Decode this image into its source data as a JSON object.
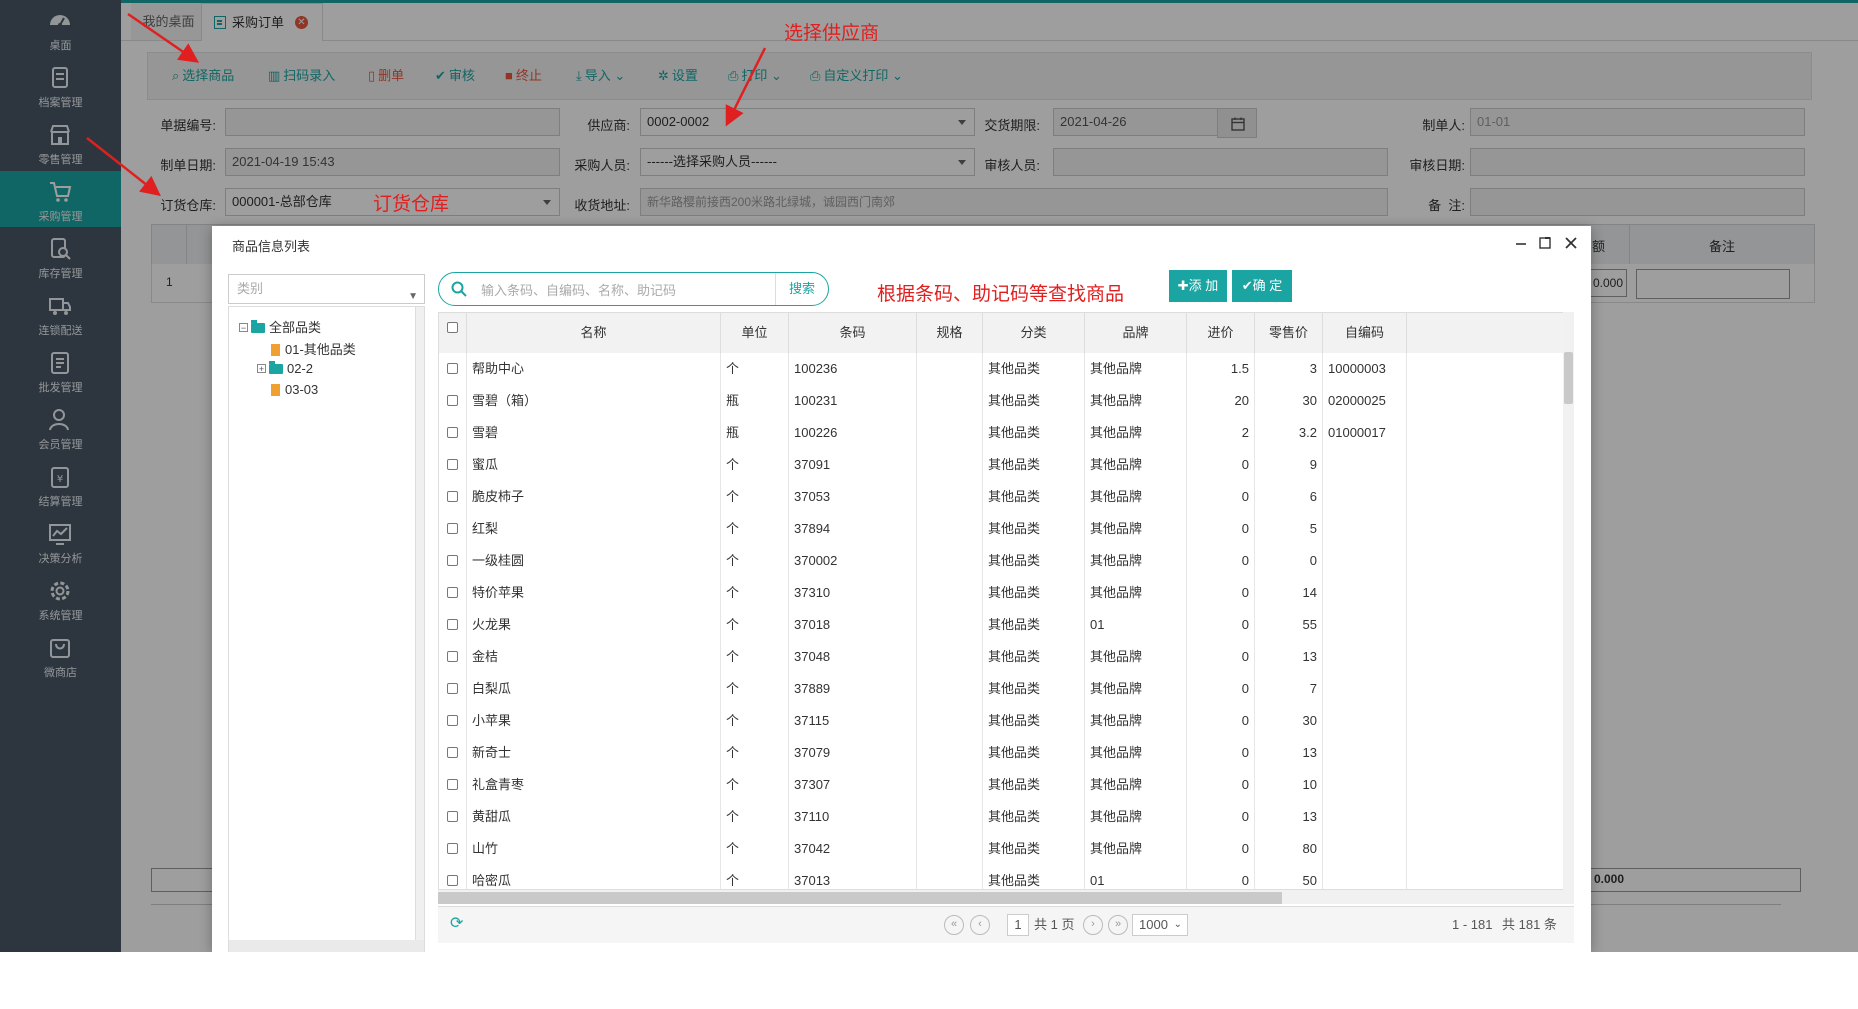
{
  "sidebar": {
    "items": [
      {
        "label": "桌面",
        "icon": "dashboard-icon"
      },
      {
        "label": "档案管理",
        "icon": "archive-icon"
      },
      {
        "label": "零售管理",
        "icon": "store-icon"
      },
      {
        "label": "采购管理",
        "icon": "purchase-icon",
        "active": true
      },
      {
        "label": "库存管理",
        "icon": "inventory-icon"
      },
      {
        "label": "连锁配送",
        "icon": "delivery-icon"
      },
      {
        "label": "批发管理",
        "icon": "wholesale-icon"
      },
      {
        "label": "会员管理",
        "icon": "member-icon"
      },
      {
        "label": "结算管理",
        "icon": "settlement-icon"
      },
      {
        "label": "决策分析",
        "icon": "analysis-icon"
      },
      {
        "label": "系统管理",
        "icon": "gear-icon"
      },
      {
        "label": "微商店",
        "icon": "shop-bag-icon"
      }
    ]
  },
  "tabs": {
    "desktop": "我的桌面",
    "purchase_order": "采购订单"
  },
  "toolbar": {
    "select_goods": "选择商品",
    "scan_entry": "扫码录入",
    "delete": "删单",
    "audit": "审核",
    "terminate": "终止",
    "import": "导入",
    "settings": "设置",
    "print": "打印",
    "custom_print": "自定义打印"
  },
  "form": {
    "doc_no_label": "单据编号:",
    "doc_no": "",
    "supplier_label": "供应商:",
    "supplier": "0002-0002",
    "deadline_label": "交货期限:",
    "deadline": "2021-04-26",
    "maker_label": "制单人:",
    "maker": "01-01",
    "date_label": "制单日期:",
    "date": "2021-04-19 15:43",
    "buyer_label": "采购人员:",
    "buyer": "------选择采购人员------",
    "auditor_label": "审核人员:",
    "auditor": "",
    "audit_date_label": "审核日期:",
    "audit_date": "",
    "warehouse_label": "订货仓库:",
    "warehouse": "000001-总部仓库",
    "address_label": "收货地址:",
    "address": "新华路樱前接西200米路北绿城，诚园西门南郊",
    "remark_label": "备  注:",
    "remark": ""
  },
  "bg_grid": {
    "remark_header": "备注",
    "row_no": "1",
    "amount": "0.000",
    "total": "0.000",
    "col_tail": "额"
  },
  "modal": {
    "title": "商品信息列表",
    "category_placeholder": "类别",
    "tree": [
      {
        "label": "全部品类"
      },
      {
        "label": "01-其他品类"
      },
      {
        "label": "02-2"
      },
      {
        "label": "03-03"
      }
    ],
    "search_placeholder": "输入条码、自编码、名称、助记码",
    "search_button": "搜索",
    "add_button": "添 加",
    "confirm_button": "确 定",
    "columns": [
      "名称",
      "单位",
      "条码",
      "规格",
      "分类",
      "品牌",
      "进价",
      "零售价",
      "自编码"
    ],
    "rows": [
      {
        "name": "帮助中心",
        "unit": "个",
        "barcode": "100236",
        "spec": "",
        "category": "其他品类",
        "brand": "其他品牌",
        "cost": "1.5",
        "price": "3",
        "code": "10000003"
      },
      {
        "name": "雪碧（箱）",
        "unit": "瓶",
        "barcode": "100231",
        "spec": "",
        "category": "其他品类",
        "brand": "其他品牌",
        "cost": "20",
        "price": "30",
        "code": "02000025"
      },
      {
        "name": "雪碧",
        "unit": "瓶",
        "barcode": "100226",
        "spec": "",
        "category": "其他品类",
        "brand": "其他品牌",
        "cost": "2",
        "price": "3.2",
        "code": "01000017"
      },
      {
        "name": "蜜瓜",
        "unit": "个",
        "barcode": "37091",
        "spec": "",
        "category": "其他品类",
        "brand": "其他品牌",
        "cost": "0",
        "price": "9",
        "code": ""
      },
      {
        "name": "脆皮柿子",
        "unit": "个",
        "barcode": "37053",
        "spec": "",
        "category": "其他品类",
        "brand": "其他品牌",
        "cost": "0",
        "price": "6",
        "code": ""
      },
      {
        "name": "红梨",
        "unit": "个",
        "barcode": "37894",
        "spec": "",
        "category": "其他品类",
        "brand": "其他品牌",
        "cost": "0",
        "price": "5",
        "code": ""
      },
      {
        "name": "一级桂圆",
        "unit": "个",
        "barcode": "370002",
        "spec": "",
        "category": "其他品类",
        "brand": "其他品牌",
        "cost": "0",
        "price": "0",
        "code": ""
      },
      {
        "name": "特价苹果",
        "unit": "个",
        "barcode": "37310",
        "spec": "",
        "category": "其他品类",
        "brand": "其他品牌",
        "cost": "0",
        "price": "14",
        "code": ""
      },
      {
        "name": "火龙果",
        "unit": "个",
        "barcode": "37018",
        "spec": "",
        "category": "其他品类",
        "brand": "01",
        "cost": "0",
        "price": "55",
        "code": ""
      },
      {
        "name": "金桔",
        "unit": "个",
        "barcode": "37048",
        "spec": "",
        "category": "其他品类",
        "brand": "其他品牌",
        "cost": "0",
        "price": "13",
        "code": ""
      },
      {
        "name": "白梨瓜",
        "unit": "个",
        "barcode": "37889",
        "spec": "",
        "category": "其他品类",
        "brand": "其他品牌",
        "cost": "0",
        "price": "7",
        "code": ""
      },
      {
        "name": "小苹果",
        "unit": "个",
        "barcode": "37115",
        "spec": "",
        "category": "其他品类",
        "brand": "其他品牌",
        "cost": "0",
        "price": "30",
        "code": ""
      },
      {
        "name": "新奇士",
        "unit": "个",
        "barcode": "37079",
        "spec": "",
        "category": "其他品类",
        "brand": "其他品牌",
        "cost": "0",
        "price": "13",
        "code": ""
      },
      {
        "name": "礼盒青枣",
        "unit": "个",
        "barcode": "37307",
        "spec": "",
        "category": "其他品类",
        "brand": "其他品牌",
        "cost": "0",
        "price": "10",
        "code": ""
      },
      {
        "name": "黄甜瓜",
        "unit": "个",
        "barcode": "37110",
        "spec": "",
        "category": "其他品类",
        "brand": "其他品牌",
        "cost": "0",
        "price": "13",
        "code": ""
      },
      {
        "name": "山竹",
        "unit": "个",
        "barcode": "37042",
        "spec": "",
        "category": "其他品类",
        "brand": "其他品牌",
        "cost": "0",
        "price": "80",
        "code": ""
      },
      {
        "name": "哈密瓜",
        "unit": "个",
        "barcode": "37013",
        "spec": "",
        "category": "其他品类",
        "brand": "01",
        "cost": "0",
        "price": "50",
        "code": ""
      }
    ],
    "pager": {
      "page": "1",
      "total_pages": "共 1 页",
      "page_size": "1000",
      "range": "1 - 181",
      "total": "共 181 条"
    }
  },
  "annotations": {
    "supplier": "选择供应商",
    "warehouse": "订货仓库",
    "search": "根据条码、助记码等查找商品"
  },
  "colors": {
    "accent": "#1aa5a2",
    "sidebar": "#4a5866",
    "annotation": "#e02020",
    "danger": "#e9573f"
  }
}
